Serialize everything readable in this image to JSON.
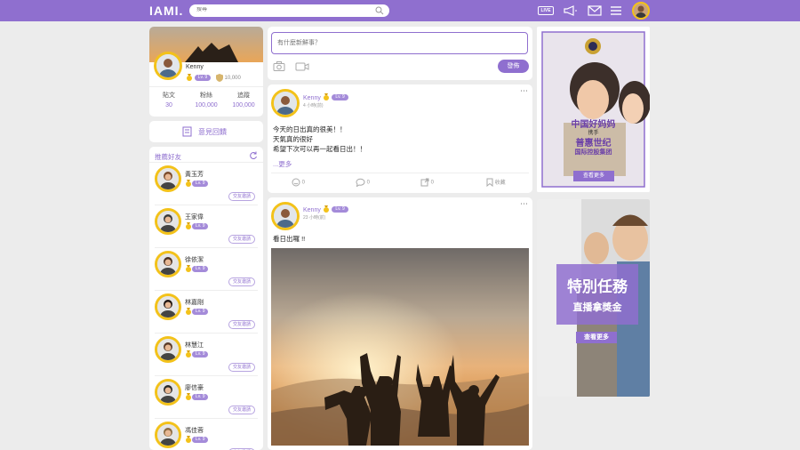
{
  "topbar": {
    "logo": "IAMI.",
    "search_placeholder": "搜尋",
    "live_label": "LIVE",
    "accent": "#8f6fcf"
  },
  "profile": {
    "name": "Kenny",
    "level": "Lv. 9",
    "points": "10,000",
    "stats": [
      {
        "label": "貼文",
        "value": "30"
      },
      {
        "label": "粉絲",
        "value": "100,000"
      },
      {
        "label": "追蹤",
        "value": "100,000"
      }
    ]
  },
  "feedback_label": "意見回饋",
  "friends": {
    "title": "推薦好友",
    "invite_label": "交友邀請",
    "items": [
      {
        "name": "黃玉芳",
        "level": "Lv. 9"
      },
      {
        "name": "王家偉",
        "level": "Lv. 9"
      },
      {
        "name": "徐依潔",
        "level": "Lv. 9"
      },
      {
        "name": "林嘉剛",
        "level": "Lv. 9"
      },
      {
        "name": "林慧江",
        "level": "Lv. 9"
      },
      {
        "name": "廖信豪",
        "level": "Lv. 9"
      },
      {
        "name": "馮佳蓉",
        "level": "Lv. 9"
      }
    ]
  },
  "composer": {
    "placeholder": "有什麼新鮮事？",
    "publish_label": "發佈"
  },
  "posts": [
    {
      "author": "Kenny",
      "level": "Lv. 9",
      "time": "4 小時(前)",
      "lines": [
        "今天的日出真的很美！！",
        "天氣真的很好",
        "希望下次可以再一起看日出！！"
      ],
      "more": "...更多",
      "likes": "0",
      "comments": "0",
      "shares": "0",
      "save_label": "收藏"
    },
    {
      "author": "Kenny",
      "level": "Lv. 9",
      "time": "23 小時(前)",
      "lines": [
        "看日出囉 !!"
      ]
    }
  ],
  "ads": [
    {
      "line1": "中国好妈妈",
      "line2": "携手",
      "line3": "普惠世纪",
      "line4": "国际控股集团",
      "cta": "查看更多"
    },
    {
      "title": "特別任務",
      "subtitle": "直播拿獎金",
      "cta": "查看更多"
    }
  ]
}
